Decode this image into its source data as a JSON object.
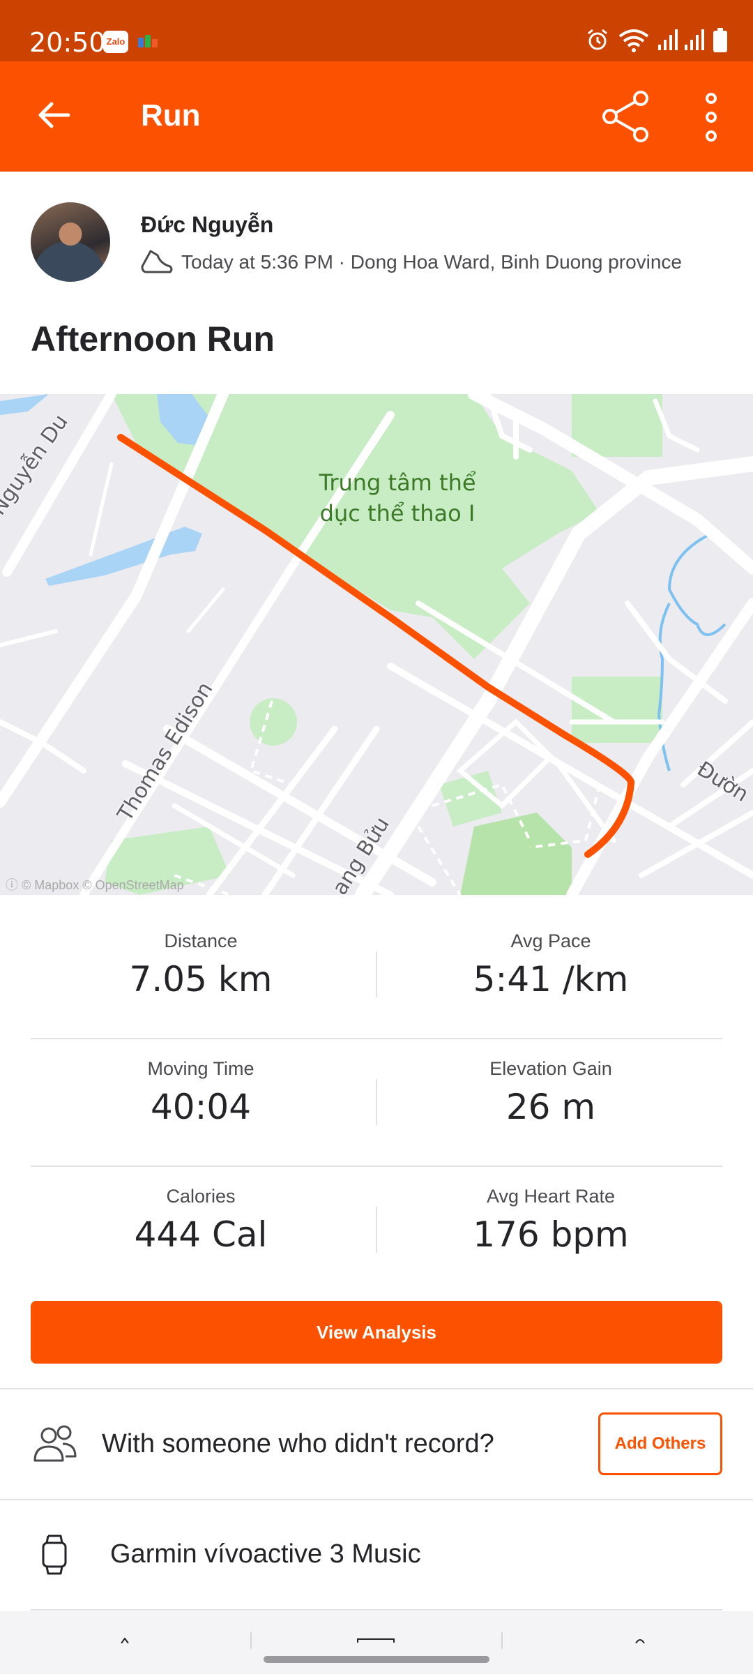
{
  "status_bar": {
    "time": "20:50",
    "notification_icons": [
      "zalo-icon",
      "app-icon"
    ],
    "system_icons": [
      "alarm-icon",
      "wifi-icon",
      "signal-icon",
      "signal-icon",
      "battery-icon"
    ],
    "zalo_label": "Zalo"
  },
  "header": {
    "title": "Run",
    "icons": [
      "back-arrow-icon",
      "share-icon",
      "more-vertical-icon"
    ]
  },
  "activity": {
    "athlete_name": "Đức Nguyễn",
    "meta": "Today at 5:36 PM · Dong Hoa Ward, Binh Duong province",
    "title": "Afternoon Run"
  },
  "map": {
    "park_label": "Trung tâm thể dục thể thao I",
    "road_labels": [
      "Nguyễn Du",
      "Thomas Edison",
      "ang Bửu",
      "Đườn"
    ],
    "attribution": "© Mapbox © OpenStreetMap",
    "route_color": "#fc5200",
    "park_color": "#c8ecc4",
    "water_color": "#a9d4f5"
  },
  "stats": [
    {
      "label": "Distance",
      "value": "7.05 km"
    },
    {
      "label": "Avg Pace",
      "value": "5:41 /km"
    },
    {
      "label": "Moving Time",
      "value": "40:04"
    },
    {
      "label": "Elevation Gain",
      "value": "26 m"
    },
    {
      "label": "Calories",
      "value": "444 Cal"
    },
    {
      "label": "Avg Heart Rate",
      "value": "176 bpm"
    }
  ],
  "actions": {
    "view_analysis": "View Analysis",
    "with_someone": "With someone who didn't record?",
    "add_others": "Add Others"
  },
  "device": {
    "name": "Garmin vívoactive 3 Music"
  },
  "colors": {
    "brand": "#fc5200",
    "status_bar": "#cc4200"
  }
}
